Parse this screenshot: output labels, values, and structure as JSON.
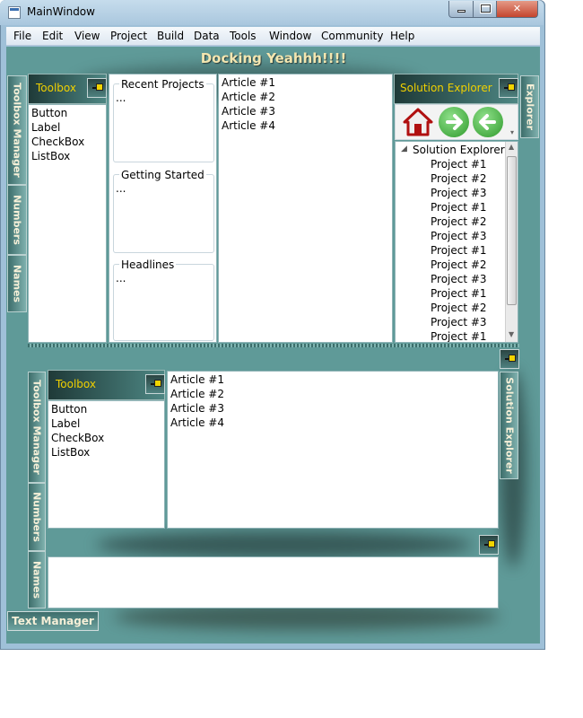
{
  "window": {
    "title": "MainWindow",
    "minimize_glyph": "minimize-icon",
    "maximize_glyph": "maximize-icon",
    "close_label": "✕"
  },
  "menu": [
    "File",
    "Edit",
    "View",
    "Project",
    "Build",
    "Data",
    "Tools",
    "Window",
    "Community",
    "Help"
  ],
  "header": {
    "title": "Docking Yeahhh!!!!"
  },
  "left_tabs": [
    "Toolbox Manager",
    "Numbers",
    "Names"
  ],
  "top_toolbox": {
    "title": "Toolbox",
    "items": [
      "Button",
      "Label",
      "CheckBox",
      "ListBox"
    ]
  },
  "groups": [
    {
      "title": "Recent Projects",
      "content": "..."
    },
    {
      "title": "Getting Started",
      "content": "..."
    },
    {
      "title": "Headlines",
      "content": "..."
    }
  ],
  "articles": [
    "Article #1",
    "Article #2",
    "Article #3",
    "Article #4"
  ],
  "solution_explorer": {
    "title": "Solution Explorer",
    "side_tab": "Explorer",
    "toolbar": [
      "home-icon",
      "forward-icon",
      "back-icon"
    ],
    "root": "Solution Explorer",
    "projects": [
      "Project #1",
      "Project #2",
      "Project #3",
      "Project #1",
      "Project #2",
      "Project #3",
      "Project #1",
      "Project #2",
      "Project #3",
      "Project #1",
      "Project #2",
      "Project #3",
      "Project #1"
    ]
  },
  "bottom_left_tabs": [
    "Toolbox Manager",
    "Numbers",
    "Names"
  ],
  "bottom_toolbox": {
    "title": "Toolbox",
    "items": [
      "Button",
      "Label",
      "CheckBox",
      "ListBox"
    ]
  },
  "bottom_articles": [
    "Article #1",
    "Article #2",
    "Article #3",
    "Article #4"
  ],
  "bottom_right_tab": "Solution Explorer",
  "text_manager_tab": "Text Manager",
  "colors": {
    "accent_yellow": "#f0d000",
    "teal": "#5f9a98",
    "dark_teal": "#1f3a38",
    "header_text": "#f3e6b0"
  }
}
